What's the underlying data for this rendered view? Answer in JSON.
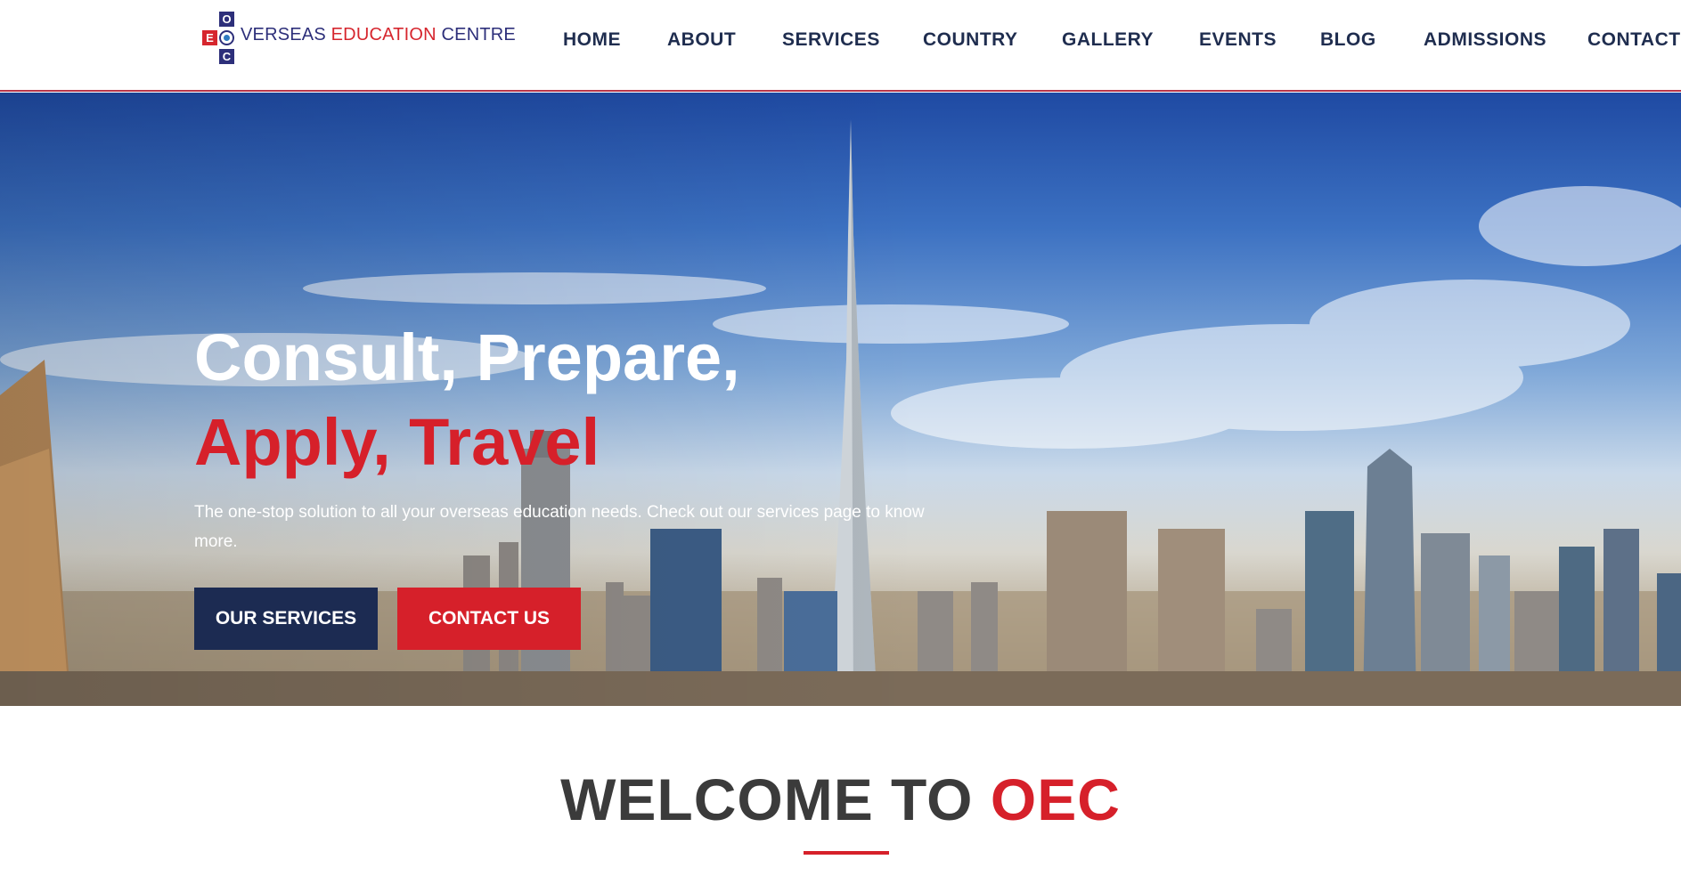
{
  "brand": {
    "logo_letters": {
      "o": "O",
      "e": "E",
      "c": "C"
    },
    "name_part1": "VERSEAS ",
    "name_part2": "EDUCATION",
    "name_part3": " CENTRE",
    "colors": {
      "navy": "#2d2f7a",
      "red": "#d6262e"
    }
  },
  "nav": {
    "items": [
      "HOME",
      "ABOUT",
      "SERVICES",
      "COUNTRY",
      "GALLERY",
      "EVENTS",
      "BLOG",
      "ADMISSIONS",
      "CONTACT"
    ]
  },
  "hero": {
    "title_line1": "Consult, Prepare,",
    "title_line2": "Apply, Travel",
    "subtitle": "The one-stop solution to all your overseas education needs. Check out our services page to know more.",
    "primary_button": "OUR SERVICES",
    "secondary_button": "CONTACT US",
    "background_image": "city-skyline-image",
    "colors": {
      "button_primary": "#1c2b52",
      "button_secondary": "#d6202a",
      "accent": "#d6202a"
    }
  },
  "welcome": {
    "heading_part1": "WELCOME TO ",
    "heading_part2": "OEC"
  }
}
